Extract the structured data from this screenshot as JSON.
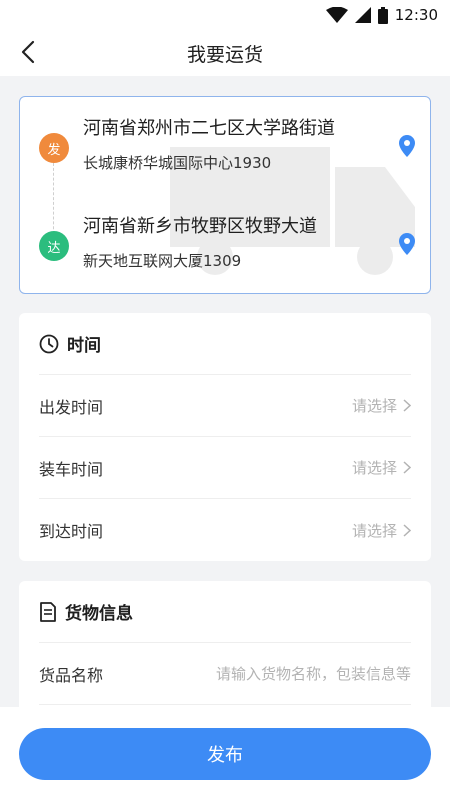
{
  "status_bar": {
    "time": "12:30",
    "icons": [
      "wifi-icon",
      "signal-icon",
      "battery-icon"
    ]
  },
  "header": {
    "title": "我要运货",
    "back_icon": "chevron-left-icon"
  },
  "route": {
    "start": {
      "badge": "发",
      "badge_color": "#f08a3c",
      "address": "河南省郑州市二七区大学路街道",
      "detail": "长城康桥华城国际中心1930"
    },
    "end": {
      "badge": "达",
      "badge_color": "#2bbd7e",
      "address": "河南省新乡市牧野区牧野大道",
      "detail": "新天地互联网大厦1309"
    },
    "pin_color": "#3d8bf5"
  },
  "time_section": {
    "title": "时间",
    "icon": "clock-icon",
    "rows": [
      {
        "label": "出发时间",
        "value": "请选择"
      },
      {
        "label": "装车时间",
        "value": "请选择"
      },
      {
        "label": "到达时间",
        "value": "请选择"
      }
    ]
  },
  "goods_section": {
    "title": "货物信息",
    "icon": "document-icon",
    "rows": [
      {
        "label": "货品名称",
        "placeholder": "请输入货物名称，包装信息等"
      }
    ]
  },
  "publish_button": {
    "label": "发布",
    "color": "#3d8bf5"
  }
}
